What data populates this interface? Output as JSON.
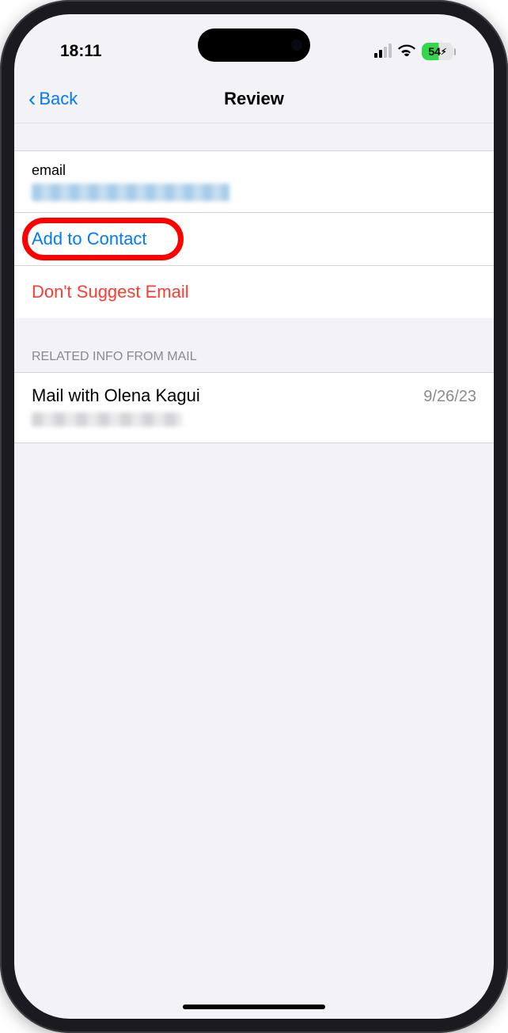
{
  "status_bar": {
    "time": "18:11",
    "battery_percent": "54"
  },
  "nav": {
    "back_label": "Back",
    "title": "Review"
  },
  "email_section": {
    "label": "email"
  },
  "actions": {
    "add_to_contact": "Add to Contact",
    "dont_suggest": "Don't Suggest Email"
  },
  "related": {
    "header": "RELATED INFO FROM MAIL",
    "items": [
      {
        "title": "Mail with Olena Kagui",
        "date": "9/26/23"
      }
    ]
  }
}
